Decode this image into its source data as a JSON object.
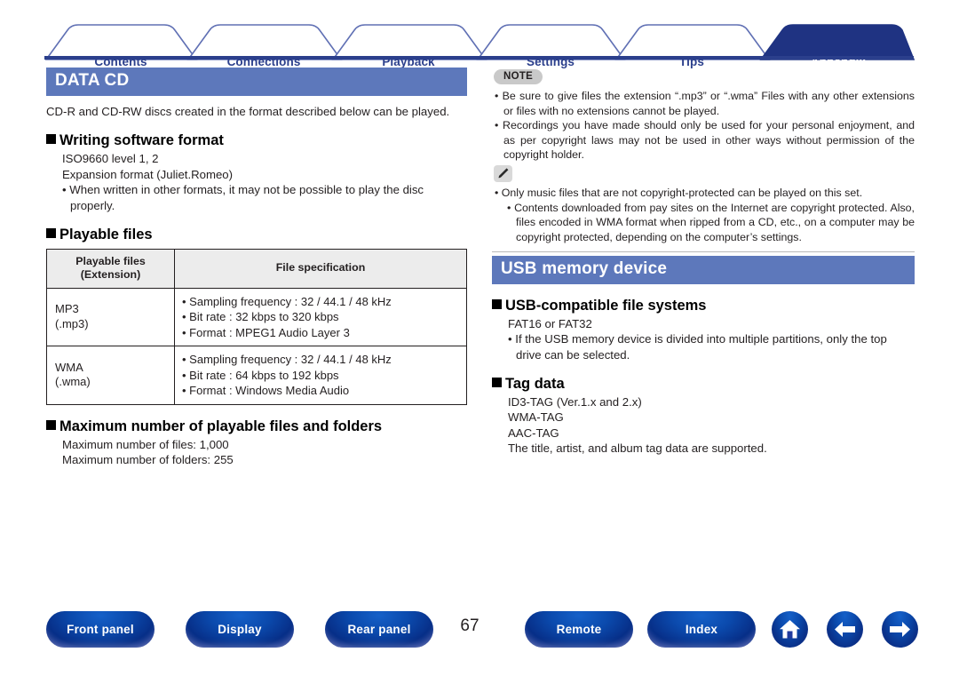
{
  "tabs": [
    {
      "label": "Contents",
      "active": false
    },
    {
      "label": "Connections",
      "active": false
    },
    {
      "label": "Playback",
      "active": false
    },
    {
      "label": "Settings",
      "active": false
    },
    {
      "label": "Tips",
      "active": false
    },
    {
      "label": "Appendix",
      "active": true
    }
  ],
  "colors": {
    "tab_text": "#2b3f8c",
    "tab_active_bg": "#1f3382",
    "section_bar_bg": "#5d78bb",
    "baseline": "#2b3f8c",
    "button_blue": "#0b4aad",
    "table_header_bg": "#ececec",
    "note_badge_bg": "#c9c9c9"
  },
  "left": {
    "section_title": "DATA CD",
    "intro": "CD-R and CD-RW discs created in the format described below can be played.",
    "writing": {
      "heading": "Writing software format",
      "lines": [
        "ISO9660 level 1, 2",
        "Expansion format (Juliet.Romeo)"
      ],
      "bullets": [
        "When written in other formats, it may not be possible to play the disc properly."
      ]
    },
    "playable": {
      "heading": "Playable files",
      "table": {
        "headers": [
          "Playable files\n(Extension)",
          "File specification"
        ],
        "header_col1_line1": "Playable files",
        "header_col1_line2": "(Extension)",
        "header_col2": "File specification",
        "rows": [
          {
            "format_line1": "MP3",
            "format_line2": "(.mp3)",
            "specs": [
              "Sampling frequency : 32 / 44.1 / 48 kHz",
              "Bit rate : 32 kbps to 320 kbps",
              "Format : MPEG1 Audio Layer 3"
            ]
          },
          {
            "format_line1": "WMA",
            "format_line2": "(.wma)",
            "specs": [
              "Sampling frequency : 32 / 44.1 / 48 kHz",
              "Bit rate : 64 kbps to 192 kbps",
              "Format : Windows Media Audio"
            ]
          }
        ]
      }
    },
    "maximum": {
      "heading": "Maximum number of playable files and folders",
      "lines": [
        "Maximum number of files: 1,000",
        "Maximum number of folders: 255"
      ]
    }
  },
  "right": {
    "note": {
      "badge": "NOTE",
      "items": [
        "Be sure to give files the extension “.mp3” or “.wma” Files with any other extensions or files with no extensions cannot be played.",
        "Recordings you have made should only be used for your personal enjoyment, and as per copyright laws may not be used in other ways without permission of the copyright holder."
      ]
    },
    "tip": {
      "badge_icon": "pencil-icon",
      "items": [
        "Only music files that are not copyright-protected can be played on this set."
      ],
      "subitems": [
        "Contents downloaded from pay sites on the Internet are copyright protected. Also, files encoded in WMA format when ripped from a CD, etc., on a computer may be copyright protected, depending on the computer’s settings."
      ]
    },
    "section_title": "USB memory device",
    "usb_fs": {
      "heading": "USB-compatible file systems",
      "lines": [
        "FAT16 or FAT32"
      ],
      "bullets": [
        "If the USB memory device is divided into multiple partitions, only the top drive can be selected."
      ]
    },
    "tag_data": {
      "heading": "Tag data",
      "lines": [
        "ID3-TAG (Ver.1.x and 2.x)",
        "WMA-TAG",
        "AAC-TAG",
        "The title, artist, and album tag data are supported."
      ]
    }
  },
  "footer": {
    "buttons": [
      {
        "label": "Front panel"
      },
      {
        "label": "Display"
      },
      {
        "label": "Rear panel"
      },
      {
        "label": "Remote"
      },
      {
        "label": "Index"
      }
    ],
    "page_number": "67",
    "icons": [
      {
        "name": "home-icon"
      },
      {
        "name": "arrow-left-icon"
      },
      {
        "name": "arrow-right-icon"
      }
    ]
  }
}
